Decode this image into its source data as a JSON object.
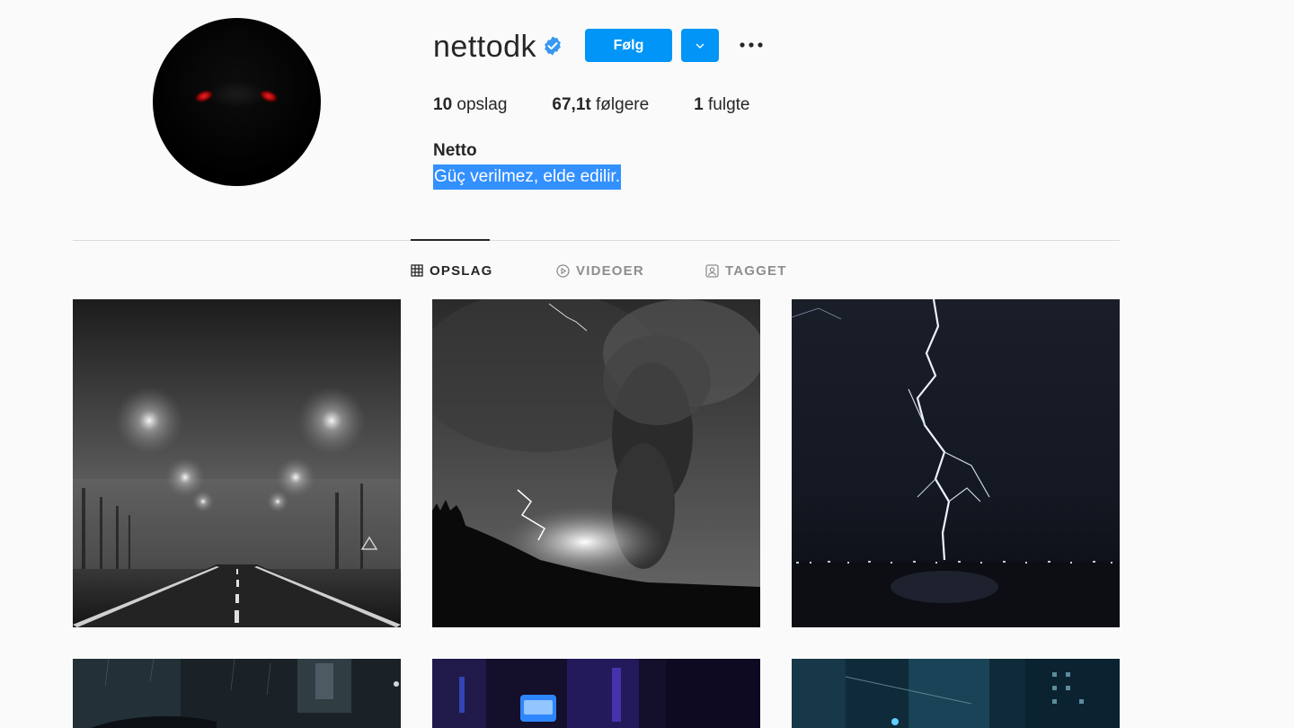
{
  "profile": {
    "username": "nettodk",
    "verified": true,
    "follow_label": "Følg",
    "stats": {
      "posts_count": "10",
      "posts_label": "opslag",
      "followers_count": "67,1t",
      "followers_label": "følgere",
      "following_count": "1",
      "following_label": "fulgte"
    },
    "full_name": "Netto",
    "bio": "Güç verilmez, elde edilir."
  },
  "tabs": [
    {
      "label": "OPSLAG",
      "icon": "grid-icon",
      "active": true
    },
    {
      "label": "VIDEOER",
      "icon": "play-icon",
      "active": false
    },
    {
      "label": "TAGGET",
      "icon": "tag-icon",
      "active": false
    }
  ],
  "posts": [
    {
      "subject": "foggy road with street lights"
    },
    {
      "subject": "volcanic ash cloud with lightning"
    },
    {
      "subject": "lightning strike over sea"
    },
    {
      "subject": "rainy night street"
    },
    {
      "subject": "neon city alley"
    },
    {
      "subject": "blue city skyline at night"
    }
  ],
  "colors": {
    "accent": "#0095f6",
    "background": "#fafafa",
    "text": "#262626",
    "muted": "#8e8e8e",
    "selection": "#3390ff"
  }
}
